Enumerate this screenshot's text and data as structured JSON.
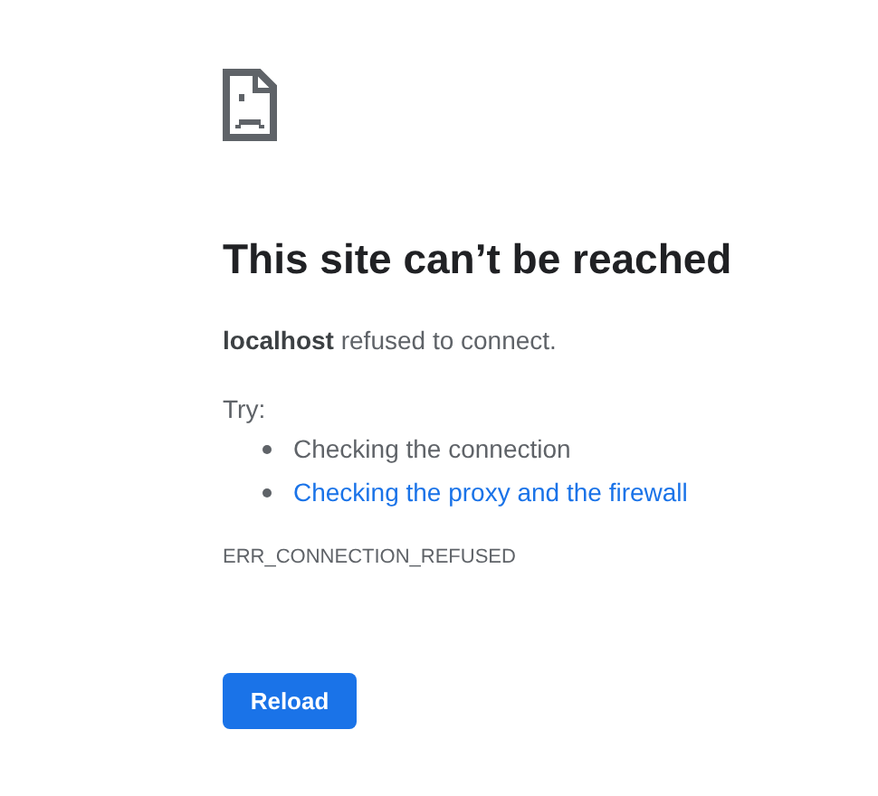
{
  "heading": "This site can’t be reached",
  "message": "**localhost** refused to connect.",
  "try_label": "Try:",
  "suggestions": [
    {
      "text": "Checking the connection",
      "kind": "text"
    },
    {
      "text": "Checking the proxy and the firewall",
      "kind": "link"
    }
  ],
  "error_code": "ERR_CONNECTION_REFUSED",
  "button": "Reload"
}
